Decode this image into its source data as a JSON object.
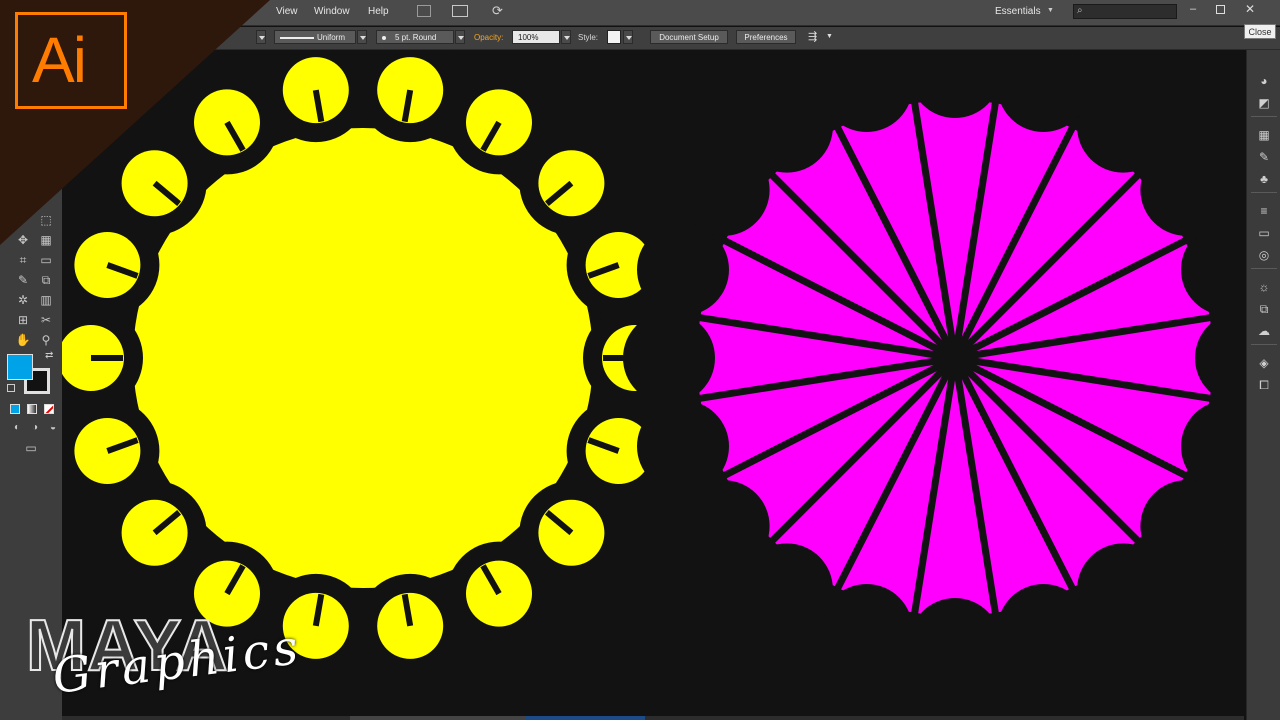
{
  "menu": {
    "items": [
      "View",
      "Window",
      "Help"
    ],
    "workspace": "Essentials"
  },
  "control_bar": {
    "stroke_profile": "Uniform",
    "brush": "5 pt. Round",
    "opacity_label": "Opacity:",
    "opacity_value": "100%",
    "style_label": "Style:",
    "document_setup": "Document Setup",
    "preferences": "Preferences"
  },
  "close_label": "Close",
  "logo": {
    "text": "Ai"
  },
  "watermark": {
    "line1": "MAYA",
    "line2": "Graphics"
  },
  "colors": {
    "yellow": "#ffff00",
    "magenta": "#ff00ff",
    "canvas": "#121212",
    "fill_swatch": "#00a2e8",
    "accent": "#ff7c00"
  }
}
